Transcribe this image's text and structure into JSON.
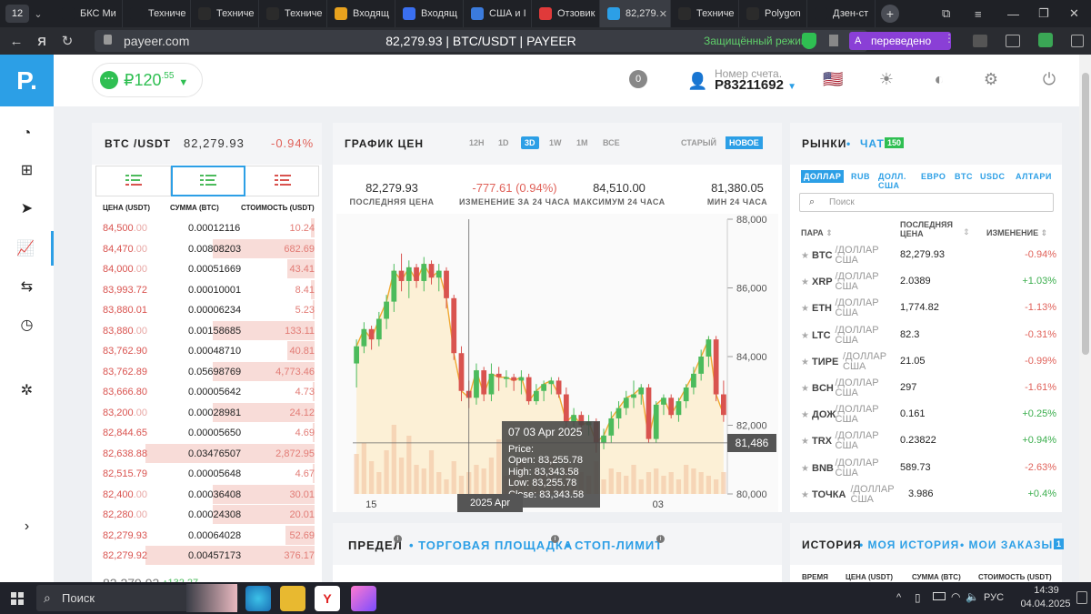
{
  "browser": {
    "tab_count": "12",
    "tabs": [
      {
        "label": "БКС Ми",
        "icon": "doc-icon",
        "color": "#1f2126"
      },
      {
        "label": "Техниче",
        "icon": "doc-icon",
        "color": "#1f2126"
      },
      {
        "label": "Техниче",
        "icon": "investing-icon",
        "color": "#2b2b2b"
      },
      {
        "label": "Техниче",
        "icon": "investing-icon",
        "color": "#2b2b2b"
      },
      {
        "label": "Входящ",
        "icon": "mail-icon",
        "color": "#e8a21e"
      },
      {
        "label": "Входящ",
        "icon": "mail-icon",
        "color": "#3a6ff0"
      },
      {
        "label": "США и I",
        "icon": "at-icon",
        "color": "#3b7bdc"
      },
      {
        "label": "Отзовик",
        "icon": "otzovik-icon",
        "color": "#e03a3a"
      },
      {
        "label": "82,279.",
        "icon": "payeer-icon",
        "color": "#2c9fe6",
        "active": true
      },
      {
        "label": "Техниче",
        "icon": "investing-icon",
        "color": "#2b2b2b"
      },
      {
        "label": "Polygon",
        "icon": "investing-icon",
        "color": "#2b2b2b"
      },
      {
        "label": "Дзен-ст",
        "icon": "zen-icon",
        "color": "#1f2126"
      }
    ],
    "url": "payeer.com",
    "page_title": "82,279.93 | BTC/USDT | PAYEER",
    "secure_label": "Защищённый режим",
    "translated_label": "переведено"
  },
  "header": {
    "balance_main": "₽120",
    "balance_cents": ".55",
    "notifications": "0",
    "account_label": "Номер счета.",
    "account_number": "P83211692"
  },
  "orderbook": {
    "pair": "BTC /USDT",
    "price": "82,279.93",
    "change": "-0.94%",
    "col_price": "ЦЕНА (USDT)",
    "col_amount": "СУММА (BTC)",
    "col_total": "СТОИМОСТЬ (USDT)",
    "rows": [
      {
        "price": "84,500",
        "frac": ".00",
        "amount": "0.00012116",
        "total": "10.24",
        "depth": 0.02
      },
      {
        "price": "84,470",
        "frac": ".00",
        "amount": "0.00808203",
        "total": "682.69",
        "depth": 0.59
      },
      {
        "price": "84,000",
        "frac": ".00",
        "amount": "0.00051669",
        "total": "43.41",
        "depth": 0.16
      },
      {
        "price": "83,993.72",
        "frac": "",
        "amount": "0.00010001",
        "total": "8.41",
        "depth": 0.02
      },
      {
        "price": "83,880.01",
        "frac": "",
        "amount": "0.00006234",
        "total": "5.23",
        "depth": 0.01
      },
      {
        "price": "83,880",
        "frac": ".00",
        "amount": "0.00158685",
        "total": "133.11",
        "depth": 0.59
      },
      {
        "price": "83,762.90",
        "frac": "",
        "amount": "0.00048710",
        "total": "40.81",
        "depth": 0.16
      },
      {
        "price": "83,762.89",
        "frac": "",
        "amount": "0.05698769",
        "total": "4,773.46",
        "depth": 0.59
      },
      {
        "price": "83,666.80",
        "frac": "",
        "amount": "0.00005642",
        "total": "4.73",
        "depth": 0.01
      },
      {
        "price": "83,200",
        "frac": ".00",
        "amount": "0.00028981",
        "total": "24.12",
        "depth": 0.59
      },
      {
        "price": "82,844.65",
        "frac": "",
        "amount": "0.00005650",
        "total": "4.69",
        "depth": 0.01
      },
      {
        "price": "82,638.88",
        "frac": "",
        "amount": "0.03476507",
        "total": "2,872.95",
        "depth": 0.98
      },
      {
        "price": "82,515.79",
        "frac": "",
        "amount": "0.00005648",
        "total": "4.67",
        "depth": 0.01
      },
      {
        "price": "82,400",
        "frac": ".00",
        "amount": "0.00036408",
        "total": "30.01",
        "depth": 0.59
      },
      {
        "price": "82,280",
        "frac": ".00",
        "amount": "0.00024308",
        "total": "20.01",
        "depth": 0.59
      },
      {
        "price": "82,279.93",
        "frac": "",
        "amount": "0.00064028",
        "total": "52.69",
        "depth": 0.17
      },
      {
        "price": "82,279.92",
        "frac": "",
        "amount": "0.00457173",
        "total": "376.17",
        "depth": 0.98
      }
    ],
    "last_price": "82,279.93",
    "last_change": "132.27"
  },
  "chart": {
    "title": "ГРАФИК ЦЕН",
    "intervals": [
      "12H",
      "1D",
      "3D",
      "1W",
      "1M",
      "ВСЕ"
    ],
    "active_interval": "3D",
    "modes": [
      "СТАРЫЙ",
      "НОВОЕ"
    ],
    "stats": [
      {
        "value": "82,279.93",
        "label": "ПОСЛЕДНЯЯ ЦЕНА",
        "color": "#333333"
      },
      {
        "value": "-777.61 (0.94%)",
        "label": "ИЗМЕНЕНИЕ ЗА 24 ЧАСА",
        "color": "#e0625a"
      },
      {
        "value": "84,510.00",
        "label": "МАКСИМУМ 24 ЧАСА",
        "color": "#333333"
      },
      {
        "value": "81,380.05",
        "label": "МИН 24 ЧАСА",
        "color": "#333333"
      }
    ],
    "tooltip": {
      "title": "07 03 Apr 2025",
      "price_label": "Price:",
      "open": "Open: 83,255.78",
      "high": "High: 83,343.58",
      "low": "Low: 83,255.78",
      "close": "Close: 83,343.58"
    },
    "crosshair_price": "81,486",
    "crosshair_date": "2025 Apr",
    "x_labels": [
      "15",
      "03"
    ],
    "up_color": "#4cbb5c",
    "down_color": "#d9534f"
  },
  "chart_data": {
    "type": "candlestick",
    "ylim": [
      80000,
      88000
    ],
    "y_ticks": [
      "88,000",
      "86,000",
      "84,000",
      "82,000",
      "80,000"
    ],
    "candles": [
      [
        83800,
        84500,
        83100,
        84300
      ],
      [
        84300,
        85000,
        84100,
        84800
      ],
      [
        84800,
        84900,
        84200,
        84500
      ],
      [
        84500,
        85300,
        84300,
        85100
      ],
      [
        85100,
        85800,
        84800,
        85600
      ],
      [
        85600,
        86700,
        85300,
        86500
      ],
      [
        86500,
        87000,
        85900,
        86200
      ],
      [
        86200,
        86800,
        85700,
        86600
      ],
      [
        86600,
        86700,
        86000,
        86200
      ],
      [
        86200,
        86900,
        85900,
        86700
      ],
      [
        86700,
        86800,
        86100,
        86300
      ],
      [
        86300,
        86700,
        85900,
        86500
      ],
      [
        86500,
        86600,
        85400,
        85700
      ],
      [
        85700,
        85800,
        83900,
        84100
      ],
      [
        84100,
        84300,
        82700,
        83000
      ],
      [
        83000,
        83300,
        82500,
        82800
      ],
      [
        82800,
        83800,
        82600,
        83600
      ],
      [
        83600,
        83700,
        82700,
        82900
      ],
      [
        82900,
        83800,
        82700,
        83500
      ],
      [
        83500,
        83700,
        83000,
        83400
      ],
      [
        83400,
        83600,
        83100,
        83400
      ],
      [
        83400,
        83500,
        83000,
        83300
      ],
      [
        83300,
        83600,
        82900,
        83400
      ],
      [
        83400,
        83500,
        82600,
        82700
      ],
      [
        82700,
        83200,
        82600,
        83000
      ],
      [
        83000,
        83300,
        82700,
        83200
      ],
      [
        83200,
        83400,
        82900,
        83300
      ],
      [
        83300,
        83400,
        82800,
        82900
      ],
      [
        82900,
        83100,
        81900,
        82100
      ],
      [
        82100,
        82500,
        81800,
        82300
      ],
      [
        82300,
        82400,
        81800,
        82000
      ],
      [
        82000,
        82300,
        81700,
        82100
      ],
      [
        82100,
        82200,
        81200,
        81500
      ],
      [
        81500,
        81900,
        81300,
        81700
      ],
      [
        81700,
        82400,
        81500,
        82200
      ],
      [
        82200,
        82700,
        81900,
        82500
      ],
      [
        82500,
        83000,
        82300,
        82800
      ],
      [
        82800,
        83300,
        82500,
        82900
      ],
      [
        82900,
        83200,
        82600,
        83100
      ],
      [
        83100,
        83200,
        81500,
        81600
      ],
      [
        81600,
        82700,
        81500,
        82600
      ],
      [
        82600,
        82900,
        82300,
        82800
      ],
      [
        82800,
        82900,
        82200,
        82300
      ],
      [
        82300,
        82800,
        82100,
        82700
      ],
      [
        82700,
        83200,
        82500,
        83100
      ],
      [
        83100,
        83700,
        82900,
        83500
      ],
      [
        83500,
        84200,
        83300,
        84000
      ],
      [
        84000,
        84600,
        83700,
        84500
      ],
      [
        84500,
        84600,
        82700,
        82900
      ],
      [
        82900,
        83300,
        82100,
        82300
      ]
    ],
    "volumes": [
      0.55,
      0.7,
      0.45,
      0.3,
      0.6,
      0.95,
      0.5,
      0.8,
      0.4,
      0.35,
      0.6,
      0.3,
      0.2,
      0.45,
      0.25,
      0.3,
      0.4,
      0.35,
      0.5,
      0.75,
      0.25,
      0.3,
      0.45,
      0.2,
      0.35,
      0.3,
      0.5,
      0.25,
      0.4,
      0.2,
      0.3,
      0.25,
      0.45,
      0.2,
      0.35,
      0.3,
      0.25,
      0.4,
      0.2,
      0.3,
      0.35,
      0.25,
      0.3,
      0.2,
      0.4,
      0.35,
      0.3,
      0.25,
      0.2,
      0.3
    ],
    "close_line_color": "#f0a830"
  },
  "markets": {
    "title": "РЫНКИ",
    "chat_label": "ЧАТ",
    "chat_count": "150",
    "currencies": [
      "ДОЛЛАР",
      "RUB",
      "ДОЛЛ. США",
      "ЕВРО",
      "BTC",
      "USDC",
      "АЛТАРИ"
    ],
    "search_placeholder": "Поиск",
    "col_pair": "ПАРА",
    "col_last": "ПОСЛЕДНЯЯ ЦЕНА",
    "col_change": "ИЗМЕНЕНИЕ",
    "quote_label_1": "/ДОЛЛАР",
    "quote_label_2": "США",
    "rows": [
      {
        "pair": "BTC",
        "price": "82,279.93",
        "change": "-0.94%",
        "up": false
      },
      {
        "pair": "XRP",
        "price": "2.0389",
        "change": "+1.03%",
        "up": true
      },
      {
        "pair": "ETH",
        "price": "1,774.82",
        "change": "-1.13%",
        "up": false
      },
      {
        "pair": "LTC",
        "price": "82.3",
        "change": "-0.31%",
        "up": false
      },
      {
        "pair": "ТИРЕ",
        "price": "21.05",
        "change": "-0.99%",
        "up": false
      },
      {
        "pair": "BCH",
        "price": "297",
        "change": "-1.61%",
        "up": false
      },
      {
        "pair": "ДОЖ",
        "price": "0.161",
        "change": "+0.25%",
        "up": true
      },
      {
        "pair": "TRX",
        "price": "0.23822",
        "change": "+0.94%",
        "up": true
      },
      {
        "pair": "BNB",
        "price": "589.73",
        "change": "-2.63%",
        "up": false
      },
      {
        "pair": "ТОЧКА",
        "price": "3.986",
        "change": "+0.4%",
        "up": true
      }
    ]
  },
  "trade": {
    "limit": "ПРЕДЕЛ",
    "market": "ТОРГОВАЯ ПЛОЩАДКА",
    "stop_limit": "СТОП-ЛИМИТ"
  },
  "history": {
    "title": "ИСТОРИЯ",
    "my_history": "МОЯ ИСТОРИЯ",
    "my_orders": "МОИ ЗАКАЗЫ",
    "orders_count": "1",
    "cols": [
      "ВРЕМЯ",
      "ЦЕНА (USDT)",
      "СУММА (BTC)",
      "СТОИМОСТЬ (USDT)"
    ]
  },
  "taskbar": {
    "search": "Поиск",
    "lang": "РУС",
    "time": "14:39",
    "date": "04.04.2025"
  }
}
